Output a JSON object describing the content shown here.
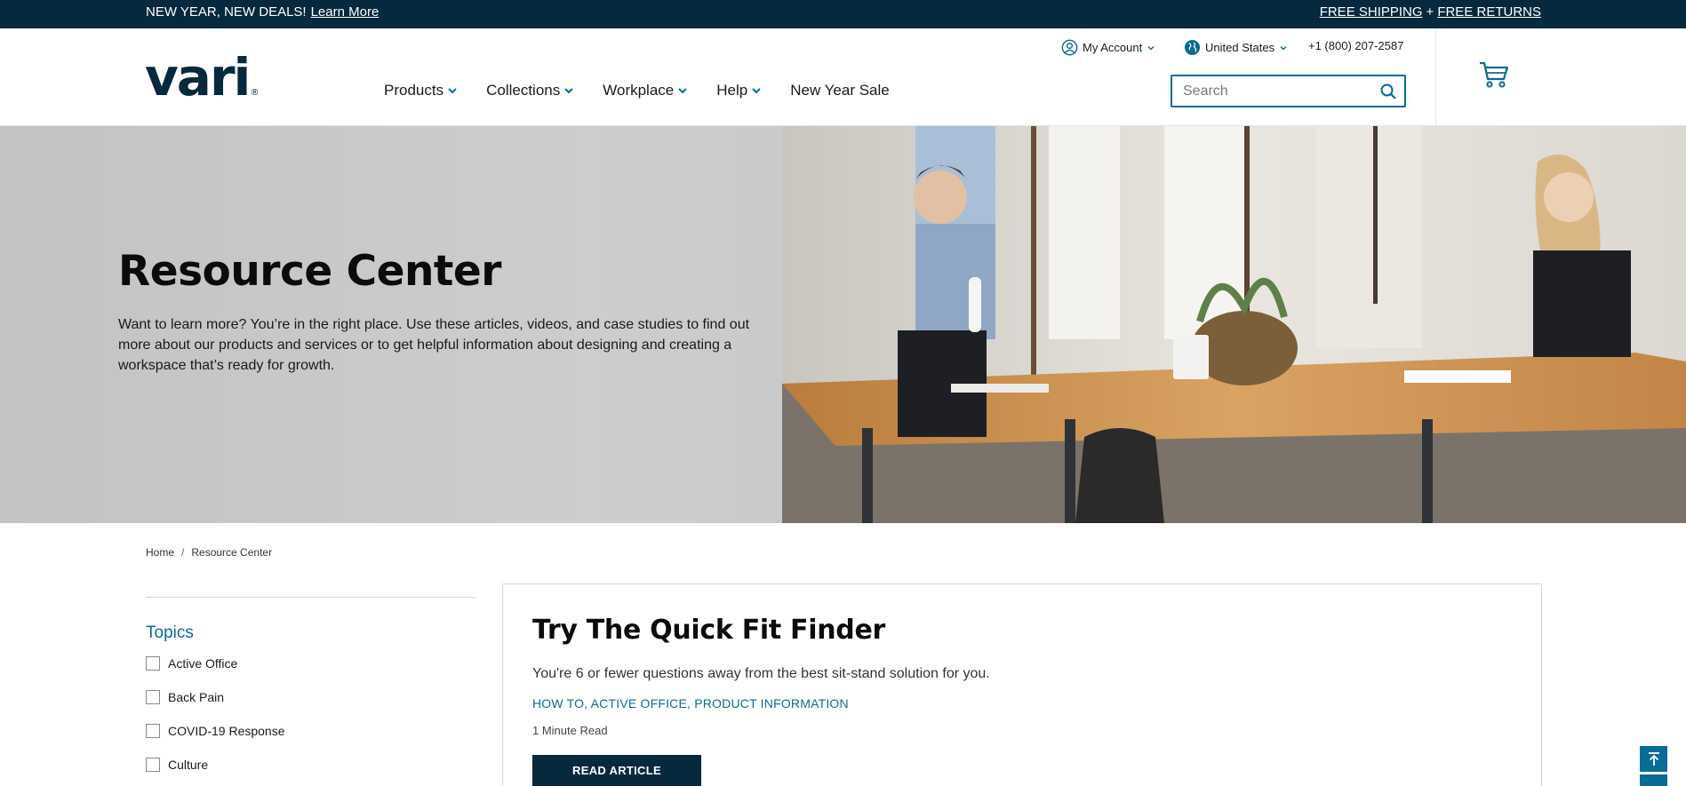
{
  "promo": {
    "text": "NEW YEAR, NEW DEALS!",
    "link": "Learn More",
    "shipping": "FREE SHIPPING",
    "plus": "+",
    "returns": "FREE RETURNS"
  },
  "header": {
    "logo": "vari",
    "logo_mark": "®",
    "account": "My Account",
    "country": "United States",
    "phone": "+1 (800) 207-2587",
    "search_placeholder": "Search",
    "nav": [
      {
        "label": "Products",
        "has_dropdown": true
      },
      {
        "label": "Collections",
        "has_dropdown": true
      },
      {
        "label": "Workplace",
        "has_dropdown": true
      },
      {
        "label": "Help",
        "has_dropdown": true
      },
      {
        "label": "New Year Sale",
        "has_dropdown": false
      }
    ]
  },
  "hero": {
    "title": "Resource Center",
    "description": "Want to learn more? You’re in the right place. Use these articles, videos, and case studies to find out more about our products and services or to get helpful information about designing and creating a workspace that’s ready for growth."
  },
  "breadcrumb": {
    "home": "Home",
    "separator": "/",
    "current": "Resource Center"
  },
  "sidebar": {
    "title": "Topics",
    "topics": [
      {
        "label": "Active Office",
        "checked": false
      },
      {
        "label": "Back Pain",
        "checked": false
      },
      {
        "label": "COVID-19 Response",
        "checked": false
      },
      {
        "label": "Culture",
        "checked": false
      }
    ]
  },
  "article": {
    "title": "Try The Quick Fit Finder",
    "description": "You're 6 or fewer questions away from the best sit-stand solution for you.",
    "tags": "HOW TO, ACTIVE OFFICE, PRODUCT INFORMATION",
    "read_time": "1 Minute Read",
    "button": "READ ARTICLE"
  },
  "colors": {
    "navy": "#07293e",
    "accent_blue": "#0a6b95"
  }
}
